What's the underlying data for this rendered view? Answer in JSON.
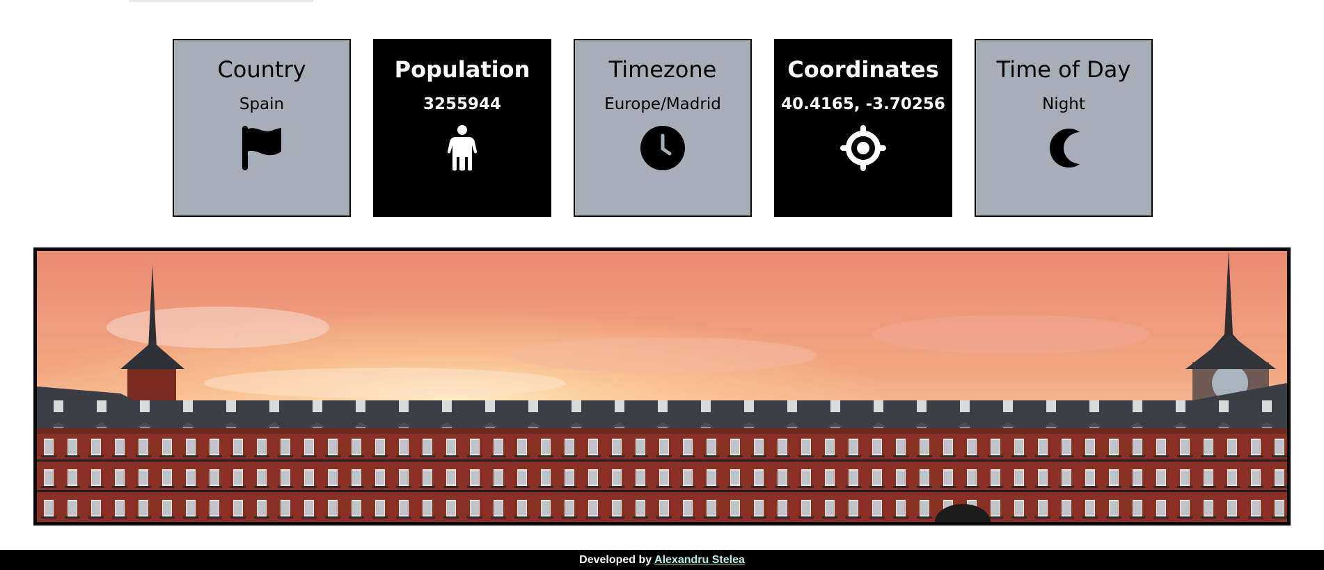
{
  "cards": [
    {
      "title": "Country",
      "value": "Spain",
      "icon": "flag-icon",
      "theme": "light"
    },
    {
      "title": "Population",
      "value": "3255944",
      "icon": "person-icon",
      "theme": "dark"
    },
    {
      "title": "Timezone",
      "value": "Europe/Madrid",
      "icon": "clock-icon",
      "theme": "light"
    },
    {
      "title": "Coordinates",
      "value": "40.4165, -3.70256",
      "icon": "crosshairs-icon",
      "theme": "dark"
    },
    {
      "title": "Time of Day",
      "value": "Night",
      "icon": "moon-icon",
      "theme": "light"
    }
  ],
  "colors": {
    "card_light_bg": "#a8aeb8",
    "card_dark_bg": "#000000",
    "footer_bg": "#000000",
    "footer_link": "#b9f3e4"
  },
  "banner": {
    "description_icon": "city-photo"
  },
  "footer": {
    "prefix": "Developed by",
    "author_link": "Alexandru Stelea"
  }
}
